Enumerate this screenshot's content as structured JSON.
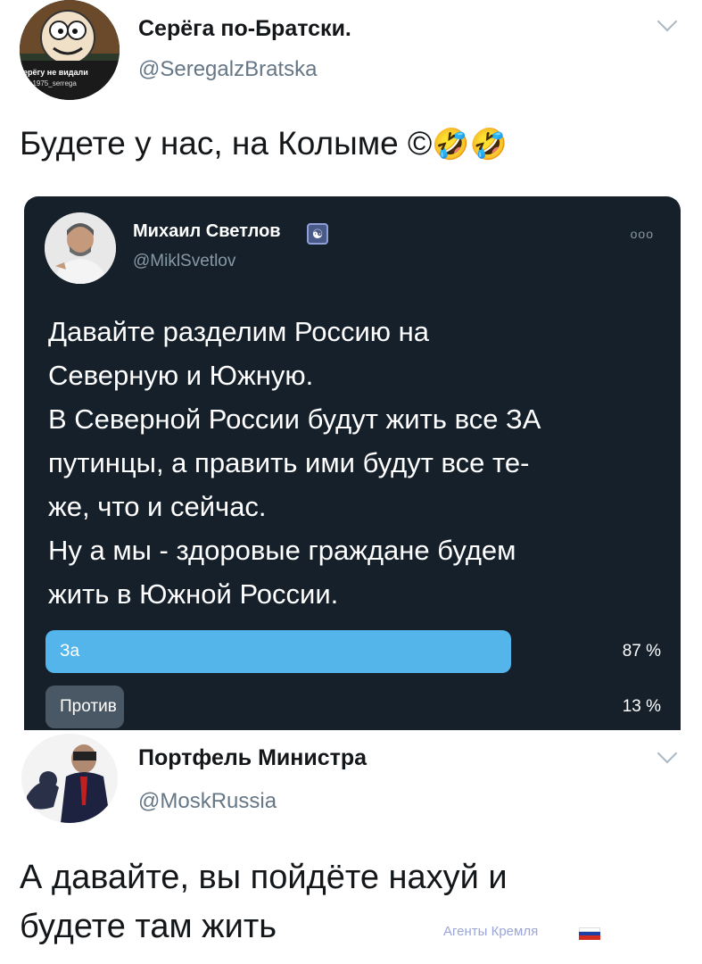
{
  "tweet1": {
    "name": "Серёга по-Братски.",
    "handle": "@SeregalzBratska",
    "avatar_caption_line1": "ерёгу не видали",
    "avatar_caption_line2": "h1975_serrega",
    "text": "Будете у нас, на Колыме ©",
    "emoji": "🤣🤣",
    "menu_icon": "chevron-down-icon"
  },
  "quoted_tweet": {
    "name": "Михаил Светлов",
    "badge_icon": "yin-yang-icon",
    "badge_glyph": "☯",
    "handle": "@MiklSvetlov",
    "more_label": "ooo",
    "text_lines": [
      "Давайте разделим Россию на",
      "Северную и Южную.",
      "В Северной России будут жить все ЗА",
      "путинцы, а править ими будут все те-",
      "же, что и сейчас.",
      "Ну а мы - здоровые граждане будем",
      "жить в Южной России."
    ],
    "poll": [
      {
        "label": "За",
        "percent_text": "87 %",
        "share": 0.87,
        "color": "#53b5ea"
      },
      {
        "label": "Против",
        "percent_text": "13 %",
        "share": 0.13,
        "color": "#4a5865"
      }
    ],
    "background": "#15202b"
  },
  "tweet2": {
    "name": "Портфель Министра",
    "handle": "@MoskRussia",
    "text_line1": "А давайте, вы пойдёте нахуй и",
    "text_line2": "будете там жить",
    "menu_icon": "chevron-down-icon"
  },
  "watermark": {
    "text": "Агенты Кремля",
    "flag_icon": "russian-flag-icon"
  }
}
